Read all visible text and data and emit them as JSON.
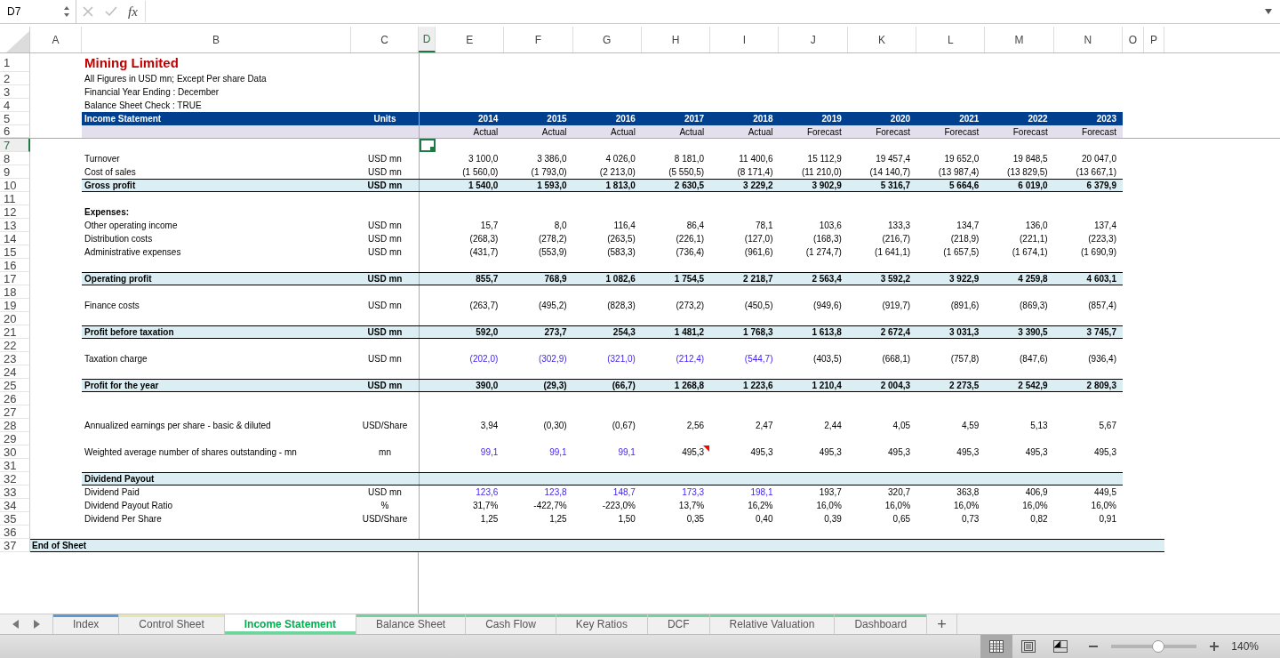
{
  "formula_bar": {
    "name_box": "D7",
    "function_label": "fx"
  },
  "columns": [
    {
      "letter": "A",
      "selected": false
    },
    {
      "letter": "B",
      "selected": false
    },
    {
      "letter": "C",
      "selected": false
    },
    {
      "letter": "D",
      "selected": true
    },
    {
      "letter": "E",
      "selected": false
    },
    {
      "letter": "F",
      "selected": false
    },
    {
      "letter": "G",
      "selected": false
    },
    {
      "letter": "H",
      "selected": false
    },
    {
      "letter": "I",
      "selected": false
    },
    {
      "letter": "J",
      "selected": false
    },
    {
      "letter": "K",
      "selected": false
    },
    {
      "letter": "L",
      "selected": false
    },
    {
      "letter": "M",
      "selected": false
    },
    {
      "letter": "N",
      "selected": false
    },
    {
      "letter": "O",
      "selected": false
    },
    {
      "letter": "P",
      "selected": false
    }
  ],
  "rows": [
    {
      "number": "1",
      "selected": false,
      "kind": "title",
      "label": "Mining Limited"
    },
    {
      "number": "2",
      "selected": false,
      "kind": "note",
      "label": "All Figures in USD mn; Except Per share Data"
    },
    {
      "number": "3",
      "selected": false,
      "kind": "note",
      "label": "Financial Year Ending : December"
    },
    {
      "number": "4",
      "selected": false,
      "kind": "note",
      "label": "Balance Sheet Check : TRUE"
    },
    {
      "number": "5",
      "selected": false,
      "kind": "header",
      "label": "Income Statement",
      "units": "Units",
      "cells": [
        {
          "text": "2014",
          "input": false
        },
        {
          "text": "2015",
          "input": false
        },
        {
          "text": "2016",
          "input": false
        },
        {
          "text": "2017",
          "input": false
        },
        {
          "text": "2018",
          "input": false
        },
        {
          "text": "2019",
          "input": false
        },
        {
          "text": "2020",
          "input": false
        },
        {
          "text": "2021",
          "input": false
        },
        {
          "text": "2022",
          "input": false
        },
        {
          "text": "2023",
          "input": false
        }
      ]
    },
    {
      "number": "6",
      "selected": false,
      "kind": "subheader",
      "cells": [
        {
          "text": "Actual",
          "input": false
        },
        {
          "text": "Actual",
          "input": false
        },
        {
          "text": "Actual",
          "input": false
        },
        {
          "text": "Actual",
          "input": false
        },
        {
          "text": "Actual",
          "input": false
        },
        {
          "text": "Forecast",
          "input": false
        },
        {
          "text": "Forecast",
          "input": false
        },
        {
          "text": "Forecast",
          "input": false
        },
        {
          "text": "Forecast",
          "input": false
        },
        {
          "text": "Forecast",
          "input": false
        }
      ]
    },
    {
      "number": "7",
      "selected": true,
      "kind": "blank"
    },
    {
      "number": "8",
      "selected": false,
      "kind": "item",
      "label": "Turnover",
      "units": "USD mn",
      "cells": [
        {
          "text": "3 100,0",
          "input": false
        },
        {
          "text": "3 386,0",
          "input": false
        },
        {
          "text": "4 026,0",
          "input": false
        },
        {
          "text": "8 181,0",
          "input": false
        },
        {
          "text": "11 400,6",
          "input": false
        },
        {
          "text": "15 112,9",
          "input": false
        },
        {
          "text": "19 457,4",
          "input": false
        },
        {
          "text": "19 652,0",
          "input": false
        },
        {
          "text": "19 848,5",
          "input": false
        },
        {
          "text": "20 047,0",
          "input": false
        }
      ]
    },
    {
      "number": "9",
      "selected": false,
      "kind": "item",
      "label": "Cost of sales",
      "units": "USD mn",
      "cells": [
        {
          "text": "(1 560,0)",
          "input": false
        },
        {
          "text": "(1 793,0)",
          "input": false
        },
        {
          "text": "(2 213,0)",
          "input": false
        },
        {
          "text": "(5 550,5)",
          "input": false
        },
        {
          "text": "(8 171,4)",
          "input": false
        },
        {
          "text": "(11 210,0)",
          "input": false
        },
        {
          "text": "(14 140,7)",
          "input": false
        },
        {
          "text": "(13 987,4)",
          "input": false
        },
        {
          "text": "(13 829,5)",
          "input": false
        },
        {
          "text": "(13 667,1)",
          "input": false
        }
      ]
    },
    {
      "number": "10",
      "selected": false,
      "kind": "total",
      "label": "Gross profit",
      "units": "USD mn",
      "cells": [
        {
          "text": "1 540,0",
          "input": false
        },
        {
          "text": "1 593,0",
          "input": false
        },
        {
          "text": "1 813,0",
          "input": false
        },
        {
          "text": "2 630,5",
          "input": false
        },
        {
          "text": "3 229,2",
          "input": false
        },
        {
          "text": "3 902,9",
          "input": false
        },
        {
          "text": "5 316,7",
          "input": false
        },
        {
          "text": "5 664,6",
          "input": false
        },
        {
          "text": "6 019,0",
          "input": false
        },
        {
          "text": "6 379,9",
          "input": false
        }
      ]
    },
    {
      "number": "11",
      "selected": false,
      "kind": "blank"
    },
    {
      "number": "12",
      "selected": false,
      "kind": "section",
      "label": "Expenses:"
    },
    {
      "number": "13",
      "selected": false,
      "kind": "item",
      "label": "Other operating income",
      "units": "USD mn",
      "cells": [
        {
          "text": "15,7",
          "input": false
        },
        {
          "text": "8,0",
          "input": false
        },
        {
          "text": "116,4",
          "input": false
        },
        {
          "text": "86,4",
          "input": false
        },
        {
          "text": "78,1",
          "input": false
        },
        {
          "text": "103,6",
          "input": false
        },
        {
          "text": "133,3",
          "input": false
        },
        {
          "text": "134,7",
          "input": false
        },
        {
          "text": "136,0",
          "input": false
        },
        {
          "text": "137,4",
          "input": false
        }
      ]
    },
    {
      "number": "14",
      "selected": false,
      "kind": "item",
      "label": "Distribution costs",
      "units": "USD mn",
      "cells": [
        {
          "text": "(268,3)",
          "input": false
        },
        {
          "text": "(278,2)",
          "input": false
        },
        {
          "text": "(263,5)",
          "input": false
        },
        {
          "text": "(226,1)",
          "input": false
        },
        {
          "text": "(127,0)",
          "input": false
        },
        {
          "text": "(168,3)",
          "input": false
        },
        {
          "text": "(216,7)",
          "input": false
        },
        {
          "text": "(218,9)",
          "input": false
        },
        {
          "text": "(221,1)",
          "input": false
        },
        {
          "text": "(223,3)",
          "input": false
        }
      ]
    },
    {
      "number": "15",
      "selected": false,
      "kind": "item",
      "label": "Administrative expenses",
      "units": "USD mn",
      "cells": [
        {
          "text": "(431,7)",
          "input": false
        },
        {
          "text": "(553,9)",
          "input": false
        },
        {
          "text": "(583,3)",
          "input": false
        },
        {
          "text": "(736,4)",
          "input": false
        },
        {
          "text": "(961,6)",
          "input": false
        },
        {
          "text": "(1 274,7)",
          "input": false
        },
        {
          "text": "(1 641,1)",
          "input": false
        },
        {
          "text": "(1 657,5)",
          "input": false
        },
        {
          "text": "(1 674,1)",
          "input": false
        },
        {
          "text": "(1 690,9)",
          "input": false
        }
      ]
    },
    {
      "number": "16",
      "selected": false,
      "kind": "blank"
    },
    {
      "number": "17",
      "selected": false,
      "kind": "total",
      "label": "Operating profit",
      "units": "USD mn",
      "cells": [
        {
          "text": "855,7",
          "input": false
        },
        {
          "text": "768,9",
          "input": false
        },
        {
          "text": "1 082,6",
          "input": false
        },
        {
          "text": "1 754,5",
          "input": false
        },
        {
          "text": "2 218,7",
          "input": false
        },
        {
          "text": "2 563,4",
          "input": false
        },
        {
          "text": "3 592,2",
          "input": false
        },
        {
          "text": "3 922,9",
          "input": false
        },
        {
          "text": "4 259,8",
          "input": false
        },
        {
          "text": "4 603,1",
          "input": false
        }
      ]
    },
    {
      "number": "18",
      "selected": false,
      "kind": "blank"
    },
    {
      "number": "19",
      "selected": false,
      "kind": "item",
      "label": "Finance costs",
      "units": "USD mn",
      "cells": [
        {
          "text": "(263,7)",
          "input": false
        },
        {
          "text": "(495,2)",
          "input": false
        },
        {
          "text": "(828,3)",
          "input": false
        },
        {
          "text": "(273,2)",
          "input": false
        },
        {
          "text": "(450,5)",
          "input": false
        },
        {
          "text": "(949,6)",
          "input": false
        },
        {
          "text": "(919,7)",
          "input": false
        },
        {
          "text": "(891,6)",
          "input": false
        },
        {
          "text": "(869,3)",
          "input": false
        },
        {
          "text": "(857,4)",
          "input": false
        }
      ]
    },
    {
      "number": "20",
      "selected": false,
      "kind": "blank"
    },
    {
      "number": "21",
      "selected": false,
      "kind": "total",
      "label": "Profit before taxation",
      "units": "USD mn",
      "cells": [
        {
          "text": "592,0",
          "input": false
        },
        {
          "text": "273,7",
          "input": false
        },
        {
          "text": "254,3",
          "input": false
        },
        {
          "text": "1 481,2",
          "input": false
        },
        {
          "text": "1 768,3",
          "input": false
        },
        {
          "text": "1 613,8",
          "input": false
        },
        {
          "text": "2 672,4",
          "input": false
        },
        {
          "text": "3 031,3",
          "input": false
        },
        {
          "text": "3 390,5",
          "input": false
        },
        {
          "text": "3 745,7",
          "input": false
        }
      ]
    },
    {
      "number": "22",
      "selected": false,
      "kind": "blank"
    },
    {
      "number": "23",
      "selected": false,
      "kind": "item",
      "label": "Taxation charge",
      "units": "USD mn",
      "cells": [
        {
          "text": "(202,0)",
          "input": true
        },
        {
          "text": "(302,9)",
          "input": true
        },
        {
          "text": "(321,0)",
          "input": true
        },
        {
          "text": "(212,4)",
          "input": true
        },
        {
          "text": "(544,7)",
          "input": true
        },
        {
          "text": "(403,5)",
          "input": false
        },
        {
          "text": "(668,1)",
          "input": false
        },
        {
          "text": "(757,8)",
          "input": false
        },
        {
          "text": "(847,6)",
          "input": false
        },
        {
          "text": "(936,4)",
          "input": false
        }
      ]
    },
    {
      "number": "24",
      "selected": false,
      "kind": "blank"
    },
    {
      "number": "25",
      "selected": false,
      "kind": "total",
      "label": "Profit for the year",
      "units": "USD mn",
      "cells": [
        {
          "text": "390,0",
          "input": false
        },
        {
          "text": "(29,3)",
          "input": false
        },
        {
          "text": "(66,7)",
          "input": false
        },
        {
          "text": "1 268,8",
          "input": false
        },
        {
          "text": "1 223,6",
          "input": false
        },
        {
          "text": "1 210,4",
          "input": false
        },
        {
          "text": "2 004,3",
          "input": false
        },
        {
          "text": "2 273,5",
          "input": false
        },
        {
          "text": "2 542,9",
          "input": false
        },
        {
          "text": "2 809,3",
          "input": false
        }
      ]
    },
    {
      "number": "26",
      "selected": false,
      "kind": "blank"
    },
    {
      "number": "27",
      "selected": false,
      "kind": "blank"
    },
    {
      "number": "28",
      "selected": false,
      "kind": "item",
      "label": "Annualized earnings per share - basic & diluted",
      "units": "USD/Share",
      "cells": [
        {
          "text": "3,94",
          "input": false
        },
        {
          "text": "(0,30)",
          "input": false
        },
        {
          "text": "(0,67)",
          "input": false
        },
        {
          "text": "2,56",
          "input": false
        },
        {
          "text": "2,47",
          "input": false
        },
        {
          "text": "2,44",
          "input": false
        },
        {
          "text": "4,05",
          "input": false
        },
        {
          "text": "4,59",
          "input": false
        },
        {
          "text": "5,13",
          "input": false
        },
        {
          "text": "5,67",
          "input": false
        }
      ]
    },
    {
      "number": "29",
      "selected": false,
      "kind": "blank"
    },
    {
      "number": "30",
      "selected": false,
      "kind": "item",
      "label": "Weighted average number of shares outstanding - mn",
      "units": "mn",
      "cells": [
        {
          "text": "99,1",
          "input": true,
          "comment": false
        },
        {
          "text": "99,1",
          "input": true,
          "comment": false
        },
        {
          "text": "99,1",
          "input": true,
          "comment": false
        },
        {
          "text": "495,3",
          "input": false,
          "comment": true
        },
        {
          "text": "495,3",
          "input": false,
          "comment": false
        },
        {
          "text": "495,3",
          "input": false,
          "comment": false
        },
        {
          "text": "495,3",
          "input": false,
          "comment": false
        },
        {
          "text": "495,3",
          "input": false,
          "comment": false
        },
        {
          "text": "495,3",
          "input": false,
          "comment": false
        },
        {
          "text": "495,3",
          "input": false,
          "comment": false
        }
      ]
    },
    {
      "number": "31",
      "selected": false,
      "kind": "blank"
    },
    {
      "number": "32",
      "selected": false,
      "kind": "total",
      "label": "Dividend Payout"
    },
    {
      "number": "33",
      "selected": false,
      "kind": "item",
      "label": "Dividend Paid",
      "units": "USD mn",
      "cells": [
        {
          "text": "123,6",
          "input": true
        },
        {
          "text": "123,8",
          "input": true
        },
        {
          "text": "148,7",
          "input": true
        },
        {
          "text": "173,3",
          "input": true
        },
        {
          "text": "198,1",
          "input": true
        },
        {
          "text": "193,7",
          "input": false
        },
        {
          "text": "320,7",
          "input": false
        },
        {
          "text": "363,8",
          "input": false
        },
        {
          "text": "406,9",
          "input": false
        },
        {
          "text": "449,5",
          "input": false
        }
      ]
    },
    {
      "number": "34",
      "selected": false,
      "kind": "item",
      "label": "Dividend Payout Ratio",
      "units": "%",
      "cells": [
        {
          "text": "31,7%",
          "input": false
        },
        {
          "text": "-422,7%",
          "input": false
        },
        {
          "text": "-223,0%",
          "input": false
        },
        {
          "text": "13,7%",
          "input": false
        },
        {
          "text": "16,2%",
          "input": false
        },
        {
          "text": "16,0%",
          "input": false
        },
        {
          "text": "16,0%",
          "input": false
        },
        {
          "text": "16,0%",
          "input": false
        },
        {
          "text": "16,0%",
          "input": false
        },
        {
          "text": "16,0%",
          "input": false
        }
      ]
    },
    {
      "number": "35",
      "selected": false,
      "kind": "item",
      "label": "Dividend Per Share",
      "units": "USD/Share",
      "cells": [
        {
          "text": "1,25",
          "input": false
        },
        {
          "text": "1,25",
          "input": false
        },
        {
          "text": "1,50",
          "input": false
        },
        {
          "text": "0,35",
          "input": false
        },
        {
          "text": "0,40",
          "input": false
        },
        {
          "text": "0,39",
          "input": false
        },
        {
          "text": "0,65",
          "input": false
        },
        {
          "text": "0,73",
          "input": false
        },
        {
          "text": "0,82",
          "input": false
        },
        {
          "text": "0,91",
          "input": false
        }
      ]
    },
    {
      "number": "36",
      "selected": false,
      "kind": "blank"
    },
    {
      "number": "37",
      "selected": false,
      "kind": "end",
      "label": "End of Sheet"
    }
  ],
  "tabs": [
    {
      "label": "Index",
      "selected": false,
      "color": "#5b9bd5"
    },
    {
      "label": "Control Sheet",
      "selected": false,
      "color": "#e6e6a6"
    },
    {
      "label": "Income Statement",
      "selected": true,
      "color": "#6fd39c"
    },
    {
      "label": "Balance Sheet",
      "selected": false,
      "color": "#6fd39c"
    },
    {
      "label": "Cash Flow",
      "selected": false,
      "color": "#6fd39c"
    },
    {
      "label": "Key Ratios",
      "selected": false,
      "color": "#6fd39c"
    },
    {
      "label": "DCF",
      "selected": false,
      "color": "#6fd39c"
    },
    {
      "label": "Relative Valuation",
      "selected": false,
      "color": "#6fd39c"
    },
    {
      "label": "Dashboard",
      "selected": false,
      "color": "#6fd39c"
    }
  ],
  "add_sheet": "+",
  "status_bar": {
    "views": [
      {
        "kind": "normal",
        "selected": true
      },
      {
        "kind": "page-layout",
        "selected": false
      },
      {
        "kind": "page-break",
        "selected": false
      }
    ],
    "zoom": {
      "level": 0.55,
      "reading": "140%"
    }
  }
}
